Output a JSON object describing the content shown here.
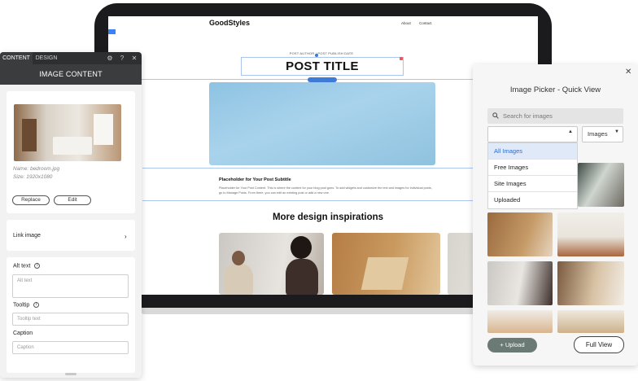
{
  "site": {
    "logo": "GoodStyles",
    "nav": [
      "About",
      "Contact"
    ],
    "post_meta": "POST AUTHOR | POST PUBLISH DATE",
    "post_title": "POST TITLE",
    "subtitle": "Placeholder for Your Post Subtitle",
    "body": "Placeholder for Your Post Content. This is where the content for your blog post goes. To add widgets and customize the text and images for individual posts, go to Manage Posts. From there, you can edit an existing post or add a new one.",
    "more_heading": "More design inspirations"
  },
  "left_panel": {
    "tabs": [
      "CONTENT",
      "DESIGN"
    ],
    "header": "IMAGE CONTENT",
    "image_name": "Name: bedroom.jpg",
    "image_size": "Size: 1920x1080",
    "replace_label": "Replace",
    "edit_label": "Edit",
    "link_image_label": "Link image",
    "alt_text_label": "Alt text",
    "alt_text_placeholder": "Alt text",
    "tooltip_label": "Tooltip",
    "tooltip_placeholder": "Tooltip text",
    "caption_label": "Caption",
    "caption_placeholder": "Caption",
    "help_glyph": "?"
  },
  "right_panel": {
    "title": "Image Picker - Quick View",
    "search_placeholder": "Search for images",
    "select_right": "Images",
    "menu_items": [
      "All Images",
      "Free Images",
      "Site Images",
      "Uploaded"
    ],
    "upload_label": "Upload",
    "full_view_label": "Full View"
  },
  "colors": {
    "accent_blue": "#3d7bd8",
    "panel_dark": "#3a3c3e",
    "upload_button": "#6c7a75"
  }
}
